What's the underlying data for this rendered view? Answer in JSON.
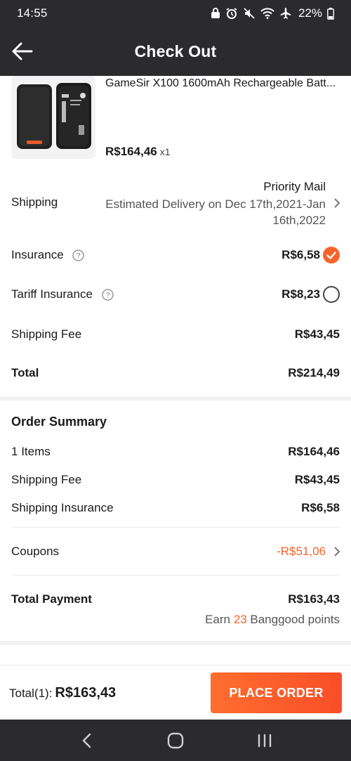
{
  "status_bar": {
    "time": "14:55",
    "battery": "22%",
    "icons": [
      "lock-icon",
      "alarm-icon",
      "mute-icon",
      "wifi-icon",
      "airplane-icon",
      "battery-icon"
    ]
  },
  "header": {
    "title": "Check Out",
    "back_icon": "arrow-left-icon"
  },
  "product": {
    "name": "GameSir X100 1600mAh Rechargeable Batt...",
    "price": "R$164,46",
    "quantity": "x1"
  },
  "shipping": {
    "label": "Shipping",
    "method": "Priority Mail",
    "eta": "Estimated Delivery on Dec 17th,2021-Jan 16th,2022"
  },
  "insurance": {
    "label": "Insurance",
    "value": "R$6,58",
    "checked": true
  },
  "tariff_insurance": {
    "label": "Tariff Insurance",
    "value": "R$8,23",
    "checked": false
  },
  "shipping_fee": {
    "label": "Shipping Fee",
    "value": "R$43,45"
  },
  "total": {
    "label": "Total",
    "value": "R$214,49"
  },
  "order_summary": {
    "title": "Order Summary",
    "items_count": "1",
    "items_label": "Items",
    "items_value": "R$164,46",
    "shipping_fee_label": "Shipping Fee",
    "shipping_fee_value": "R$43,45",
    "shipping_insurance_label": "Shipping Insurance",
    "shipping_insurance_value": "R$6,58",
    "coupons_label": "Coupons",
    "coupons_value": "-R$51,06",
    "total_payment_label": "Total Payment",
    "total_payment_value": "R$163,43",
    "earn_prefix": "Earn",
    "earn_points": "23",
    "earn_suffix": "Banggood points"
  },
  "bottom_bar": {
    "total_label": "Total(1):",
    "total_value": "R$163,43",
    "place_order_label": "PLACE ORDER"
  },
  "colors": {
    "accent": "#f7642a",
    "header_bg": "#2b2b2e"
  }
}
